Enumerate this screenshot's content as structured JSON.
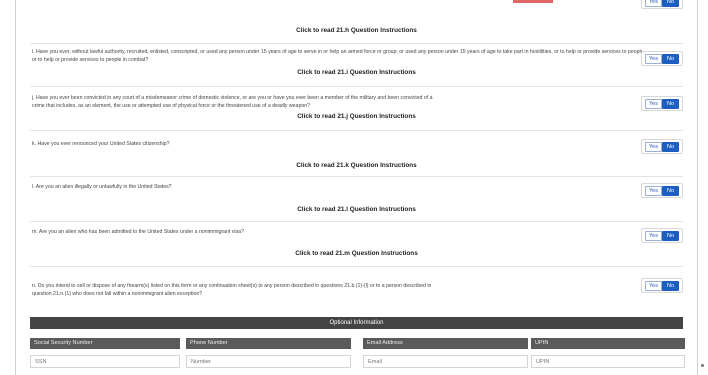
{
  "instructions": {
    "h": "Click to read 21.h Question Instructions",
    "i": "Click to read 21.i Question Instructions",
    "j": "Click to read 21.j Question Instructions",
    "k": "Click to read 21.k Question Instructions",
    "l": "Click to read 21.l Question Instructions",
    "m": "Click to read 21.m Question Instructions"
  },
  "questions": [
    {
      "id": "i",
      "text": "i. Have you ever, without lawful authority, recruited, enlisted, conscripted, or used any person under 15 years of age to serve in or help an armed force or group; or used any person under 15 years of age to take part in hostilities, or to help or provide services to people in combat?",
      "line2": "or to help or provide services to people in combat?"
    },
    {
      "id": "j",
      "text": "j. Have you ever been convicted in any court of a misdemeanor crime of domestic violence, or are you or have you ever been a member of the military and been convicted of a",
      "line2": "crime that includes, as an element, the use or attempted use of physical force or the threatened use of a deadly weapon?"
    },
    {
      "id": "k",
      "text": "k. Have you ever renounced your United States citizenship?",
      "line2": ""
    },
    {
      "id": "l",
      "text": "l. Are you an alien illegally or unlawfully in the United States?",
      "line2": ""
    },
    {
      "id": "m",
      "text": "m. Are you an alien who has been admitted to the United States under a nonimmigrant visa?",
      "line2": ""
    },
    {
      "id": "n",
      "text": "n. Do you intend to sell or dispose of any firearm(s) listed on this form or any continuation sheet(s) to any person described in questions 21.b.(1)-(l) or to a person described in",
      "line2": "question 21.n.(1) who does not fall within a nonimmigrant alien exception?"
    }
  ],
  "yes_label": "Yes",
  "no_label": "No",
  "optional": {
    "title": "Optional Information",
    "fields": [
      {
        "label": "Social Security Number",
        "placeholder": "SSN"
      },
      {
        "label": "Phone Number",
        "placeholder": "Number"
      },
      {
        "label": "Email Address",
        "placeholder": "Email"
      },
      {
        "label": "UPIN",
        "placeholder": "UPIN"
      }
    ]
  },
  "colors": {
    "accent": "#1d5fc1",
    "header_bar": "#444444",
    "label_bar": "#5a5a5a",
    "top_accent": "#e06666"
  }
}
